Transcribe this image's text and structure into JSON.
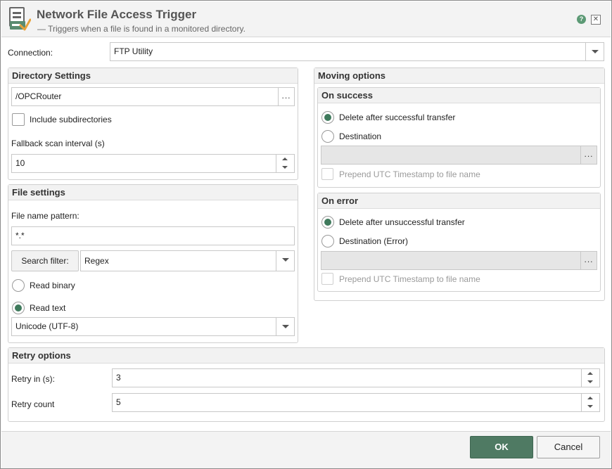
{
  "header": {
    "title": "Network File Access Trigger",
    "subtitle": "— Triggers when a file is found in a monitored directory.",
    "help_label": "?",
    "close_label": "✕",
    "icon": "file-trigger-icon"
  },
  "connection": {
    "label": "Connection:",
    "value": "FTP Utility"
  },
  "directory_settings": {
    "title": "Directory Settings",
    "path": "/OPCRouter",
    "browse_label": "...",
    "include_subdirectories_label": "Include subdirectories",
    "include_subdirectories": false,
    "fallback_label": "Fallback scan interval (s)",
    "fallback_value": "10"
  },
  "file_settings": {
    "title": "File settings",
    "pattern_label": "File name pattern:",
    "pattern_value": "*.*",
    "search_filter_label": "Search filter:",
    "search_filter_value": "Regex",
    "read_binary_label": "Read binary",
    "read_text_label": "Read text",
    "read_mode": "text",
    "encoding": "Unicode (UTF-8)"
  },
  "moving_options": {
    "title": "Moving options",
    "on_success": {
      "title": "On success",
      "delete_label": "Delete after successful transfer",
      "destination_label": "Destination",
      "selected": "delete",
      "destination_value": "",
      "browse_label": "...",
      "prepend_label": "Prepend UTC Timestamp to file name"
    },
    "on_error": {
      "title": "On error",
      "delete_label": "Delete after unsuccessful transfer",
      "destination_label": "Destination (Error)",
      "selected": "delete",
      "destination_value": "",
      "browse_label": "...",
      "prepend_label": "Prepend UTC Timestamp to file name"
    }
  },
  "retry_options": {
    "title": "Retry options",
    "retry_in_label": "Retry in (s):",
    "retry_in_value": "3",
    "retry_count_label": "Retry count",
    "retry_count_value": "5"
  },
  "footer": {
    "ok_label": "OK",
    "cancel_label": "Cancel"
  },
  "colors": {
    "accent": "#4f7a63",
    "radio_dot": "#3f7a5c",
    "header_bg": "#f3f3f3"
  }
}
